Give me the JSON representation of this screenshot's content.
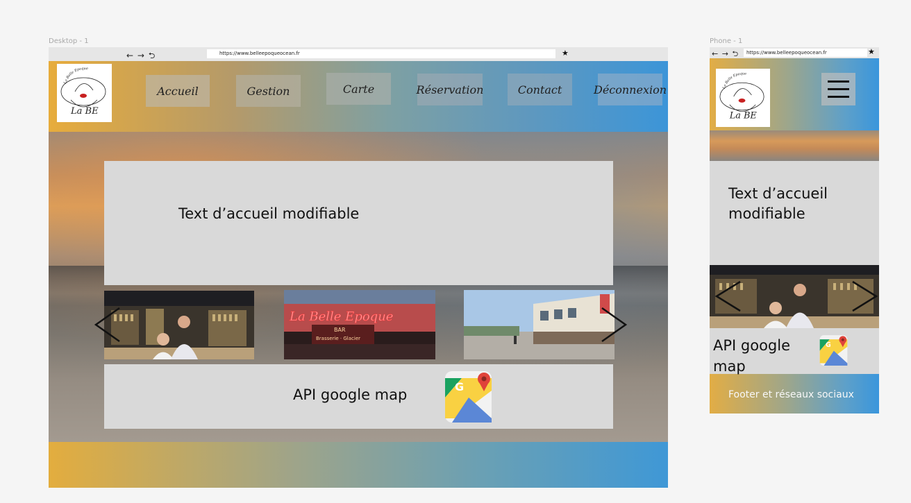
{
  "desktop": {
    "frame_label": "Desktop - 1",
    "browser": {
      "nav": "← → ⮌",
      "url": "https://www.belleepoqueocean.fr"
    },
    "nav_items": [
      "Accueil",
      "Gestion",
      "Carte",
      "Réservation",
      "Contact",
      "Déconnexion"
    ],
    "welcome_text": "Text d’accueil modifiable",
    "map_text": "API google map",
    "logo_text": "La BE",
    "logo_arc_text": "La Belle Epoque",
    "sign_text": "La Belle Epoque",
    "sign_sub": "BAR",
    "sign_sub2": "Brasserie · Glacier"
  },
  "phone": {
    "frame_label": "Phone  - 1",
    "browser": {
      "nav": "← → ⮌",
      "url": "https://www.belleepoqueocean.fr"
    },
    "welcome_text_line1": "Text d’accueil",
    "welcome_text_line2": "modifiable",
    "map_text_line1": "API google",
    "map_text_line2": "map",
    "footer_text": "Footer et réseaux sociaux",
    "logo_text": "La BE",
    "logo_arc_text": "La Belle Epoque"
  },
  "colors": {
    "accent_orange": "#e7ac3c",
    "accent_blue": "#3c95d8",
    "panel_gray": "#d9d9d9"
  },
  "icons": [
    "arrow-left-icon",
    "arrow-right-icon",
    "refresh-icon",
    "star-icon",
    "google-maps-icon",
    "hamburger-menu-icon",
    "chevron-left-icon",
    "chevron-right-icon"
  ]
}
